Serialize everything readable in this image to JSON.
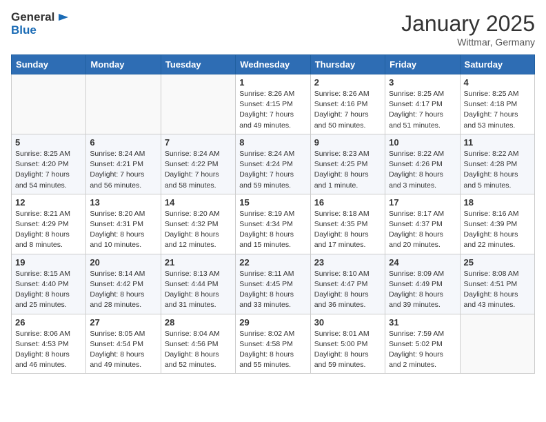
{
  "header": {
    "logo_general": "General",
    "logo_blue": "Blue",
    "month_title": "January 2025",
    "subtitle": "Wittmar, Germany"
  },
  "weekdays": [
    "Sunday",
    "Monday",
    "Tuesday",
    "Wednesday",
    "Thursday",
    "Friday",
    "Saturday"
  ],
  "weeks": [
    [
      {
        "day": "",
        "info": ""
      },
      {
        "day": "",
        "info": ""
      },
      {
        "day": "",
        "info": ""
      },
      {
        "day": "1",
        "info": "Sunrise: 8:26 AM\nSunset: 4:15 PM\nDaylight: 7 hours and 49 minutes."
      },
      {
        "day": "2",
        "info": "Sunrise: 8:26 AM\nSunset: 4:16 PM\nDaylight: 7 hours and 50 minutes."
      },
      {
        "day": "3",
        "info": "Sunrise: 8:25 AM\nSunset: 4:17 PM\nDaylight: 7 hours and 51 minutes."
      },
      {
        "day": "4",
        "info": "Sunrise: 8:25 AM\nSunset: 4:18 PM\nDaylight: 7 hours and 53 minutes."
      }
    ],
    [
      {
        "day": "5",
        "info": "Sunrise: 8:25 AM\nSunset: 4:20 PM\nDaylight: 7 hours and 54 minutes."
      },
      {
        "day": "6",
        "info": "Sunrise: 8:24 AM\nSunset: 4:21 PM\nDaylight: 7 hours and 56 minutes."
      },
      {
        "day": "7",
        "info": "Sunrise: 8:24 AM\nSunset: 4:22 PM\nDaylight: 7 hours and 58 minutes."
      },
      {
        "day": "8",
        "info": "Sunrise: 8:24 AM\nSunset: 4:24 PM\nDaylight: 7 hours and 59 minutes."
      },
      {
        "day": "9",
        "info": "Sunrise: 8:23 AM\nSunset: 4:25 PM\nDaylight: 8 hours and 1 minute."
      },
      {
        "day": "10",
        "info": "Sunrise: 8:22 AM\nSunset: 4:26 PM\nDaylight: 8 hours and 3 minutes."
      },
      {
        "day": "11",
        "info": "Sunrise: 8:22 AM\nSunset: 4:28 PM\nDaylight: 8 hours and 5 minutes."
      }
    ],
    [
      {
        "day": "12",
        "info": "Sunrise: 8:21 AM\nSunset: 4:29 PM\nDaylight: 8 hours and 8 minutes."
      },
      {
        "day": "13",
        "info": "Sunrise: 8:20 AM\nSunset: 4:31 PM\nDaylight: 8 hours and 10 minutes."
      },
      {
        "day": "14",
        "info": "Sunrise: 8:20 AM\nSunset: 4:32 PM\nDaylight: 8 hours and 12 minutes."
      },
      {
        "day": "15",
        "info": "Sunrise: 8:19 AM\nSunset: 4:34 PM\nDaylight: 8 hours and 15 minutes."
      },
      {
        "day": "16",
        "info": "Sunrise: 8:18 AM\nSunset: 4:35 PM\nDaylight: 8 hours and 17 minutes."
      },
      {
        "day": "17",
        "info": "Sunrise: 8:17 AM\nSunset: 4:37 PM\nDaylight: 8 hours and 20 minutes."
      },
      {
        "day": "18",
        "info": "Sunrise: 8:16 AM\nSunset: 4:39 PM\nDaylight: 8 hours and 22 minutes."
      }
    ],
    [
      {
        "day": "19",
        "info": "Sunrise: 8:15 AM\nSunset: 4:40 PM\nDaylight: 8 hours and 25 minutes."
      },
      {
        "day": "20",
        "info": "Sunrise: 8:14 AM\nSunset: 4:42 PM\nDaylight: 8 hours and 28 minutes."
      },
      {
        "day": "21",
        "info": "Sunrise: 8:13 AM\nSunset: 4:44 PM\nDaylight: 8 hours and 31 minutes."
      },
      {
        "day": "22",
        "info": "Sunrise: 8:11 AM\nSunset: 4:45 PM\nDaylight: 8 hours and 33 minutes."
      },
      {
        "day": "23",
        "info": "Sunrise: 8:10 AM\nSunset: 4:47 PM\nDaylight: 8 hours and 36 minutes."
      },
      {
        "day": "24",
        "info": "Sunrise: 8:09 AM\nSunset: 4:49 PM\nDaylight: 8 hours and 39 minutes."
      },
      {
        "day": "25",
        "info": "Sunrise: 8:08 AM\nSunset: 4:51 PM\nDaylight: 8 hours and 43 minutes."
      }
    ],
    [
      {
        "day": "26",
        "info": "Sunrise: 8:06 AM\nSunset: 4:53 PM\nDaylight: 8 hours and 46 minutes."
      },
      {
        "day": "27",
        "info": "Sunrise: 8:05 AM\nSunset: 4:54 PM\nDaylight: 8 hours and 49 minutes."
      },
      {
        "day": "28",
        "info": "Sunrise: 8:04 AM\nSunset: 4:56 PM\nDaylight: 8 hours and 52 minutes."
      },
      {
        "day": "29",
        "info": "Sunrise: 8:02 AM\nSunset: 4:58 PM\nDaylight: 8 hours and 55 minutes."
      },
      {
        "day": "30",
        "info": "Sunrise: 8:01 AM\nSunset: 5:00 PM\nDaylight: 8 hours and 59 minutes."
      },
      {
        "day": "31",
        "info": "Sunrise: 7:59 AM\nSunset: 5:02 PM\nDaylight: 9 hours and 2 minutes."
      },
      {
        "day": "",
        "info": ""
      }
    ]
  ]
}
